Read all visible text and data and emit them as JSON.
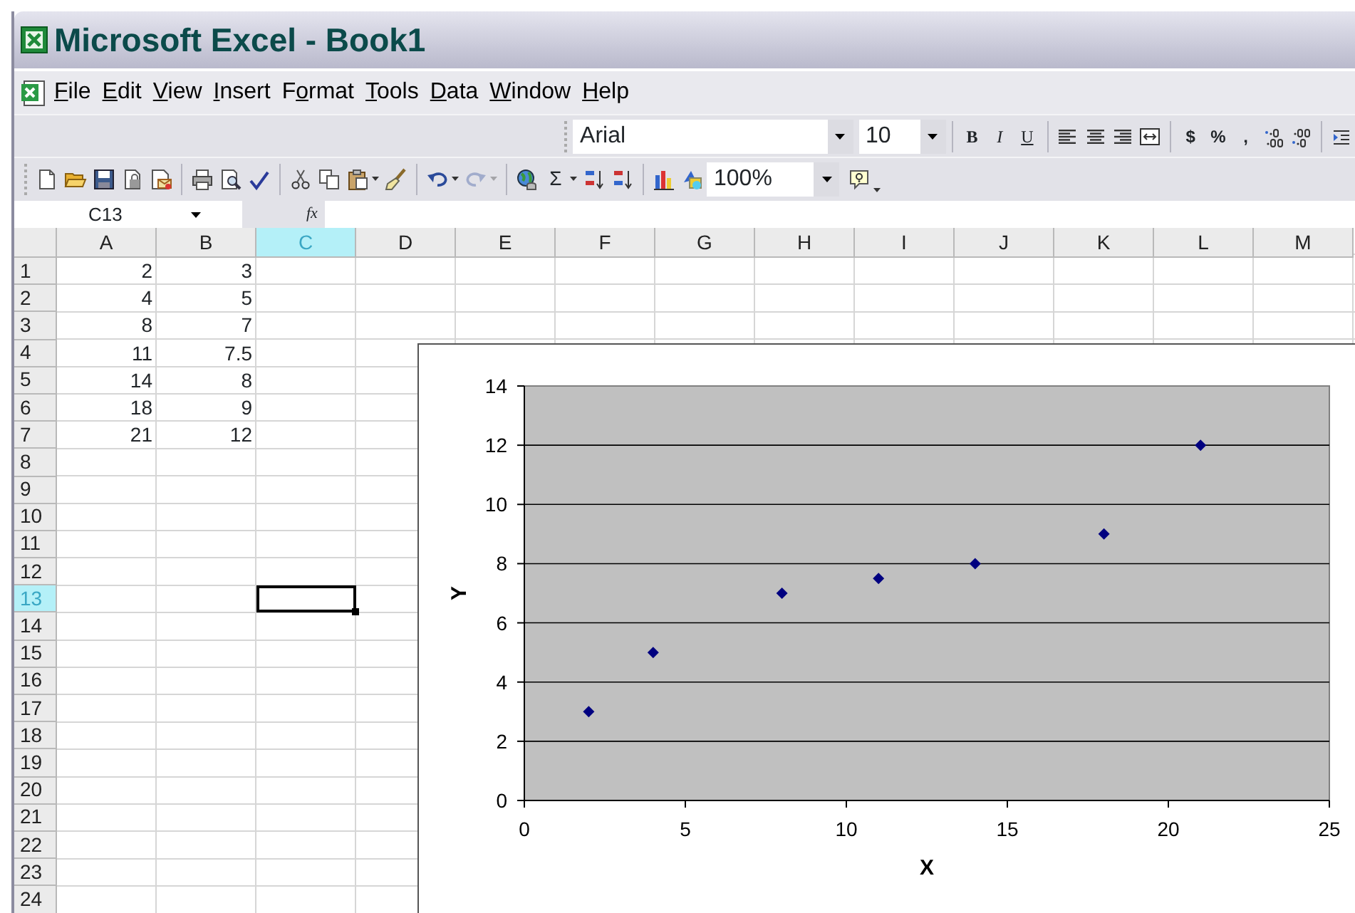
{
  "window": {
    "title": "Microsoft Excel - Book1"
  },
  "menu": [
    {
      "access_key": "F",
      "after": "ile"
    },
    {
      "access_key": "E",
      "after": "dit"
    },
    {
      "access_key": "V",
      "after": "iew"
    },
    {
      "access_key": "I",
      "after": "nsert"
    },
    {
      "before": "F",
      "access_key": "o",
      "after": "rmat"
    },
    {
      "access_key": "T",
      "after": "ools"
    },
    {
      "access_key": "D",
      "after": "ata"
    },
    {
      "access_key": "W",
      "after": "indow"
    },
    {
      "access_key": "H",
      "after": "elp"
    }
  ],
  "formatting_toolbar": {
    "font": "Arial",
    "size": "10",
    "style_buttons": [
      {
        "kind": "bold",
        "label": "B"
      },
      {
        "kind": "italic",
        "label": "I"
      },
      {
        "kind": "underline",
        "label": "U"
      }
    ],
    "number_buttons": [
      {
        "label": "$"
      },
      {
        "label": "%"
      },
      {
        "label": ","
      }
    ]
  },
  "standard_toolbar": {
    "autosum": "Σ",
    "zoom": "100%",
    "redo": {
      "disabled": true
    }
  },
  "formula_bar": {
    "name_box": "C13",
    "function_label": "fx"
  },
  "sheet": {
    "columns": [
      {
        "label": "A",
        "selected": false
      },
      {
        "label": "B",
        "selected": false
      },
      {
        "label": "C",
        "selected": true
      },
      {
        "label": "D",
        "selected": false
      },
      {
        "label": "E",
        "selected": false
      },
      {
        "label": "F",
        "selected": false
      },
      {
        "label": "G",
        "selected": false
      },
      {
        "label": "H",
        "selected": false
      },
      {
        "label": "I",
        "selected": false
      },
      {
        "label": "J",
        "selected": false
      },
      {
        "label": "K",
        "selected": false
      },
      {
        "label": "L",
        "selected": false
      },
      {
        "label": "M",
        "selected": false
      }
    ],
    "rows": [
      {
        "label": "1",
        "selected": false,
        "cells": [
          "2",
          "3"
        ]
      },
      {
        "label": "2",
        "selected": false,
        "cells": [
          "4",
          "5"
        ]
      },
      {
        "label": "3",
        "selected": false,
        "cells": [
          "8",
          "7"
        ]
      },
      {
        "label": "4",
        "selected": false,
        "cells": [
          "11",
          "7.5"
        ]
      },
      {
        "label": "5",
        "selected": false,
        "cells": [
          "14",
          "8"
        ]
      },
      {
        "label": "6",
        "selected": false,
        "cells": [
          "18",
          "9"
        ]
      },
      {
        "label": "7",
        "selected": false,
        "cells": [
          "21",
          "12"
        ]
      },
      {
        "label": "8",
        "selected": false
      },
      {
        "label": "9",
        "selected": false
      },
      {
        "label": "10",
        "selected": false
      },
      {
        "label": "11",
        "selected": false
      },
      {
        "label": "12",
        "selected": false
      },
      {
        "label": "13",
        "selected": true
      },
      {
        "label": "14",
        "selected": false
      },
      {
        "label": "15",
        "selected": false
      },
      {
        "label": "16",
        "selected": false
      },
      {
        "label": "17",
        "selected": false
      },
      {
        "label": "18",
        "selected": false
      },
      {
        "label": "19",
        "selected": false
      },
      {
        "label": "20",
        "selected": false
      },
      {
        "label": "21",
        "selected": false
      },
      {
        "label": "22",
        "selected": false
      },
      {
        "label": "23",
        "selected": false
      },
      {
        "label": "24",
        "selected": false
      }
    ]
  },
  "chart": {
    "chart_data": {
      "type": "scatter",
      "xlabel": "X",
      "ylabel": "Y",
      "grid": true,
      "series": [
        {
          "color": "#000080",
          "x": [
            2,
            4,
            8,
            11,
            14,
            18,
            21
          ],
          "values": [
            3,
            5,
            7,
            7.5,
            8,
            9,
            12
          ]
        }
      ],
      "xlim": [
        0,
        25
      ],
      "ylim": [
        0,
        14
      ],
      "xticks": [
        0,
        5,
        10,
        15,
        20,
        25
      ],
      "yticks": [
        0,
        2,
        4,
        6,
        8,
        10,
        12,
        14
      ]
    }
  }
}
